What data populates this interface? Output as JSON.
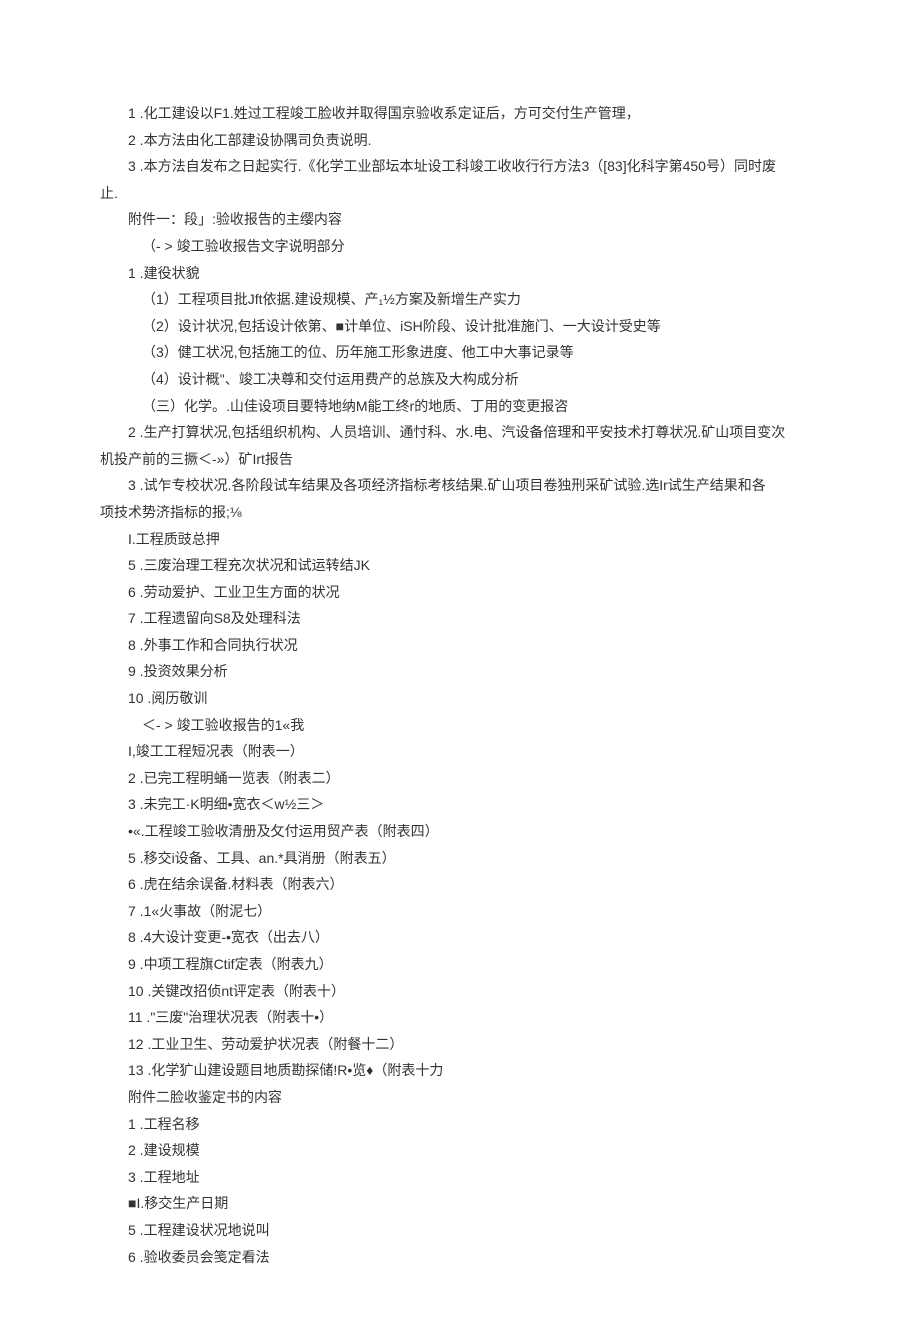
{
  "lines": [
    {
      "cls": "line",
      "text": "1 .化工建设以F1.姓过工程竣工脸收并取得国京验收系定证后，方可交付生产管理，"
    },
    {
      "cls": "line",
      "text": "2 .本方法由化工部建设协隅司负责说明."
    },
    {
      "cls": "line",
      "text": "3 .本方法自发布之日起实行.《化学工业部坛本址设工科竣工收收行行方法3（[83]化科字第450号）同时废"
    },
    {
      "cls": "line noindent",
      "text": "止."
    },
    {
      "cls": "line",
      "text": "附件一：段」:验收报告的主缨内容"
    },
    {
      "cls": "line sub",
      "text": "（- > 竣工验收报告文字说明部分"
    },
    {
      "cls": "line",
      "text": "1 .建役状貌"
    },
    {
      "cls": "line sub",
      "text": "（1）工程项目批Jft依据.建设规模、产₁½方案及新增生产实力"
    },
    {
      "cls": "line sub",
      "text": "（2）设计状况,包括设计依第、■计单位、iSH阶段、设计批准施门、一大设计受史等"
    },
    {
      "cls": "line sub",
      "text": "（3）健工状况,包括施工的位、历年施工形象进度、他工中大事记录等"
    },
    {
      "cls": "line sub",
      "text": "（4）设计概\"、竣工决尊和交付运用费产的总族及大构成分析"
    },
    {
      "cls": "line sub",
      "text": "（三）化学。.山佳设项目要特地纳M能工终r的地质、丁用的变更报咨"
    },
    {
      "cls": "line",
      "text": "2 .生产打算状况,包括组织机构、人员培训、通忖科、水.电、汽设备倍理和平安技术打尊状况.矿山项目变次"
    },
    {
      "cls": "line noindent",
      "text": "机投产前的三撅＜-»）矿Irt报告"
    },
    {
      "cls": "line",
      "text": "3 .试乍专校状况.各阶段试车结果及各项经济指标考核结果.矿山项目卷独刑采矿试验.选Ir试生产结果和各"
    },
    {
      "cls": "line noindent",
      "text": "项技术势济指标的报;⅛"
    },
    {
      "cls": "line",
      "text": "I.工程质豉总押"
    },
    {
      "cls": "line",
      "text": "5 .三废治理工程充次状况和试运转结JK"
    },
    {
      "cls": "line",
      "text": "6 .劳动爱护、工业卫生方面的状况"
    },
    {
      "cls": "line",
      "text": "7 .工程遗留向S8及处理科法"
    },
    {
      "cls": "line",
      "text": "8 .外事工作和合同执行状况"
    },
    {
      "cls": "line",
      "text": "9 .投资效果分析"
    },
    {
      "cls": "line",
      "text": "10 .阅历敬训"
    },
    {
      "cls": "line sub",
      "text": "＜- > 竣工验收报告的1«我"
    },
    {
      "cls": "line",
      "text": "I,竣工工程短况表（附表一）"
    },
    {
      "cls": "line",
      "text": "2 .已完工程明蛹一览表（附表二）"
    },
    {
      "cls": "line",
      "text": "3 .未完工·K明细•宽衣＜w½三＞"
    },
    {
      "cls": "line",
      "text": "•«.工程竣工验收清册及攵付运用贸产表（附表四）"
    },
    {
      "cls": "line",
      "text": "5 .移交i设备、工具、an.*具消册（附表五）"
    },
    {
      "cls": "line",
      "text": "6 .虎在结余误备.材料表（附表六）"
    },
    {
      "cls": "line",
      "text": "7 .1«火事故（附泥七）"
    },
    {
      "cls": "line",
      "text": "8 .4大设计变更-•宽衣（出去八）"
    },
    {
      "cls": "line",
      "text": "9 .中项工程旗Ctif定表（附表九）"
    },
    {
      "cls": "line",
      "text": "10 .关键改招侦nt评定表（附表十）"
    },
    {
      "cls": "line",
      "text": "11 .\"三废\"治理状况表（附表十•）"
    },
    {
      "cls": "line",
      "text": "12 .工业卫生、劳动爱护状况表（附餐十二）"
    },
    {
      "cls": "line",
      "text": "13 .化学犷山建设题目地质勘探储!R•览♦（附表十力"
    },
    {
      "cls": "line",
      "text": "附件二脸收鉴定书的内容"
    },
    {
      "cls": "line",
      "text": "1 .工程名移"
    },
    {
      "cls": "line",
      "text": "2 .建设规模"
    },
    {
      "cls": "line",
      "text": "3 .工程地址"
    },
    {
      "cls": "line",
      "text": "■I.移交生产日期"
    },
    {
      "cls": "line",
      "text": "5 .工程建设状况地说叫"
    },
    {
      "cls": "line",
      "text": "6 .验收委员会笺定看法"
    }
  ]
}
